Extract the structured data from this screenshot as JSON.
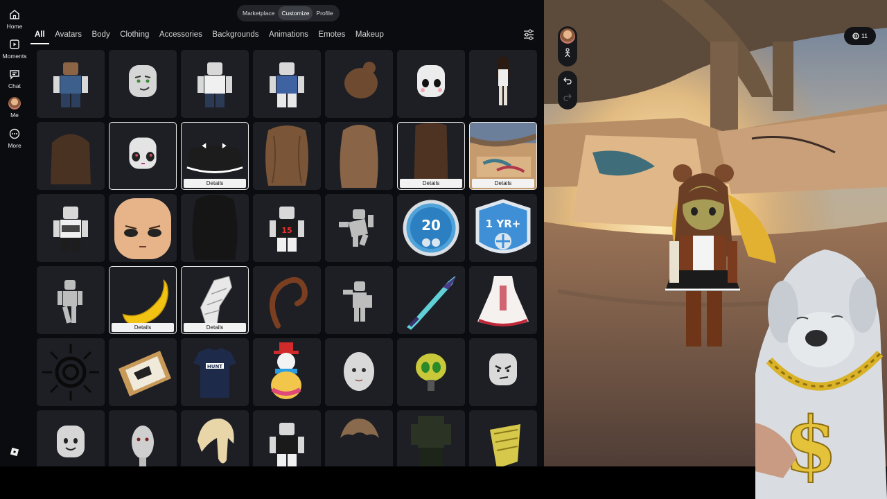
{
  "nav": {
    "items": [
      {
        "label": "Home",
        "icon": "home-icon"
      },
      {
        "label": "Moments",
        "icon": "moments-icon"
      },
      {
        "label": "Chat",
        "icon": "chat-icon"
      },
      {
        "label": "Me",
        "icon": "avatar"
      },
      {
        "label": "More",
        "icon": "more-icon"
      }
    ]
  },
  "top_tabs": [
    "Marketplace",
    "Customize",
    "Profile"
  ],
  "top_tabs_active": "Customize",
  "categories": [
    "All",
    "Avatars",
    "Body",
    "Clothing",
    "Accessories",
    "Backgrounds",
    "Animations",
    "Emotes",
    "Makeup"
  ],
  "categories_active": "All",
  "details_label": "Details",
  "robux": {
    "value": "11"
  },
  "items": [
    {
      "kind": "avatar-blue"
    },
    {
      "kind": "face-smirk"
    },
    {
      "kind": "avatar-white"
    },
    {
      "kind": "avatar-vest"
    },
    {
      "kind": "hair-bun"
    },
    {
      "kind": "face-mask"
    },
    {
      "kind": "avatar-doll"
    },
    {
      "kind": "hair-long-brown"
    },
    {
      "kind": "face-cute",
      "selected": true
    },
    {
      "kind": "skirt",
      "selected": true,
      "details": true
    },
    {
      "kind": "hair-wavy"
    },
    {
      "kind": "hair-straight"
    },
    {
      "kind": "hair-back",
      "selected": true,
      "details": true
    },
    {
      "kind": "bg-skatepark",
      "selected": true,
      "details": true
    },
    {
      "kind": "avatar-shirt"
    },
    {
      "kind": "head-skin"
    },
    {
      "kind": "hair-black"
    },
    {
      "kind": "avatar-15"
    },
    {
      "kind": "anim-pose"
    },
    {
      "kind": "badge-20"
    },
    {
      "kind": "badge-1yr"
    },
    {
      "kind": "anim-pose2"
    },
    {
      "kind": "banana",
      "selected": true,
      "details": true
    },
    {
      "kind": "bandage-arm",
      "selected": true,
      "details": true
    },
    {
      "kind": "tail"
    },
    {
      "kind": "anim-pose3"
    },
    {
      "kind": "sword"
    },
    {
      "kind": "dress"
    },
    {
      "kind": "spiral-seal"
    },
    {
      "kind": "frame"
    },
    {
      "kind": "tshirt-hunt"
    },
    {
      "kind": "snowman"
    },
    {
      "kind": "head-bald"
    },
    {
      "kind": "alien"
    },
    {
      "kind": "face-angry"
    },
    {
      "kind": "face-classic"
    },
    {
      "kind": "head-man"
    },
    {
      "kind": "hair-blonde"
    },
    {
      "kind": "avatar-black"
    },
    {
      "kind": "hair-short"
    },
    {
      "kind": "dark-avatar"
    },
    {
      "kind": "wing-yellow"
    }
  ],
  "badge_texts": {
    "badge_20": "20",
    "badge_1yr": "1 YR+",
    "shirt_15": "15",
    "hunt": "HUNT"
  },
  "colors": {
    "accent": "#ffffff",
    "tile_bg": "#1d1f24",
    "page_bg": "#0b0c0f"
  }
}
